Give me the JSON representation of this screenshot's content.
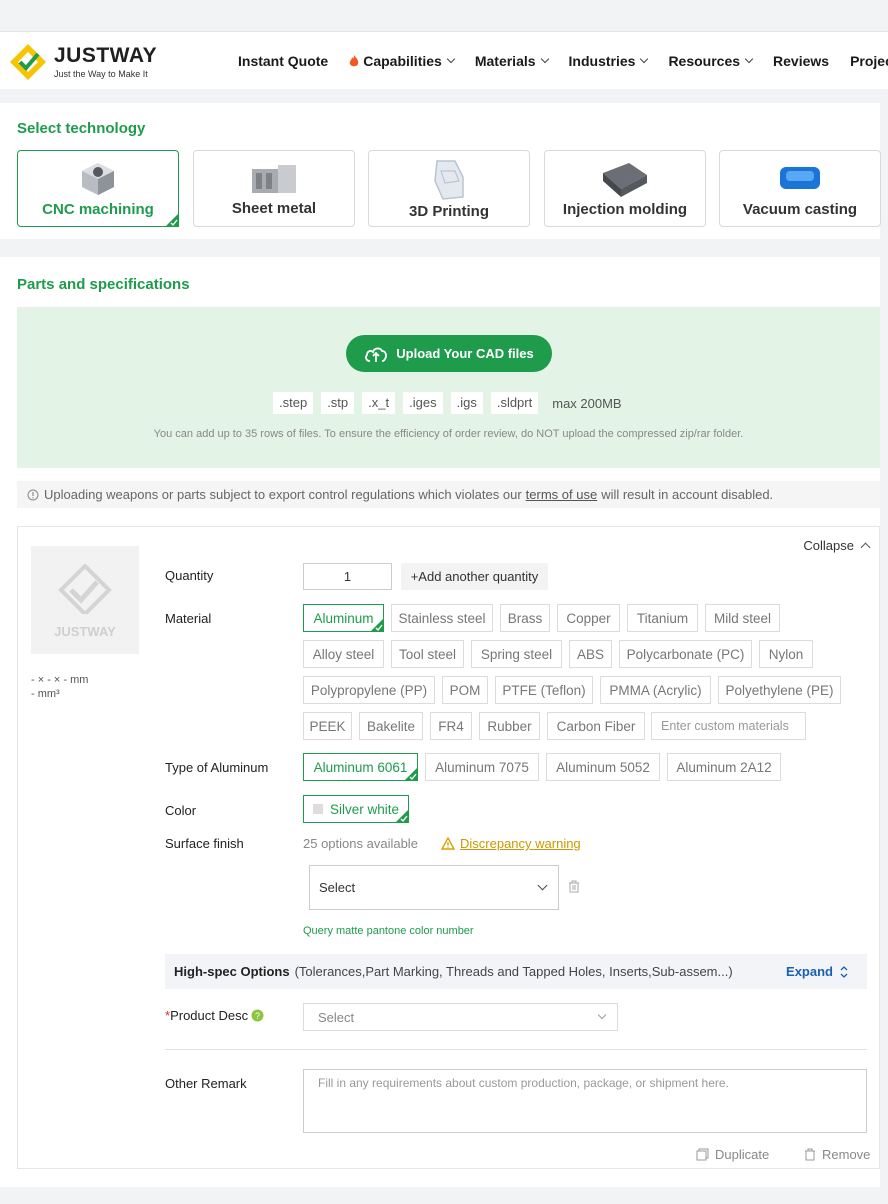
{
  "header": {
    "logo_text": "JUSTWAY",
    "logo_tagline": "Just the Way to Make It",
    "nav": [
      {
        "label": "Instant Quote",
        "dropdown": false
      },
      {
        "label": "Capabilities",
        "dropdown": true,
        "icon": "fire-icon"
      },
      {
        "label": "Materials",
        "dropdown": true
      },
      {
        "label": "Industries",
        "dropdown": true
      },
      {
        "label": "Resources",
        "dropdown": true
      },
      {
        "label": "Reviews",
        "dropdown": false
      },
      {
        "label": "Project",
        "dropdown": false
      }
    ]
  },
  "technology": {
    "title": "Select technology",
    "options": [
      {
        "label": "CNC machining",
        "selected": true
      },
      {
        "label": "Sheet metal",
        "selected": false
      },
      {
        "label": "3D Printing",
        "selected": false
      },
      {
        "label": "Injection molding",
        "selected": false
      },
      {
        "label": "Vacuum casting",
        "selected": false
      }
    ]
  },
  "parts": {
    "title": "Parts and specifications",
    "upload_button": "Upload Your CAD files",
    "extensions": [
      ".step",
      ".stp",
      ".x_t",
      ".iges",
      ".igs",
      ".sldprt"
    ],
    "max_size": "max 200MB",
    "note": "You can add up to 35 rows of files. To ensure the efficiency of order review, do NOT upload the compressed zip/rar folder.",
    "warning_prefix": "Uploading weapons or parts subject to export control regulations which violates our",
    "warning_link": "terms of use",
    "warning_suffix": "will result in account disabled."
  },
  "spec": {
    "collapse_label": "Collapse",
    "thumb_logo": "JUSTWAY",
    "dims_line1": "- × - × - mm",
    "dims_line2": "- mm³",
    "quantity_label": "Quantity",
    "quantity_value": "1",
    "add_quantity": "+Add another quantity",
    "material_label": "Material",
    "materials": [
      "Aluminum",
      "Stainless steel",
      "Brass",
      "Copper",
      "Titanium",
      "Mild steel",
      "Alloy steel",
      "Tool steel",
      "Spring steel",
      "ABS",
      "Polycarbonate (PC)",
      "Nylon",
      "Polypropylene (PP)",
      "POM",
      "PTFE (Teflon)",
      "PMMA (Acrylic)",
      "Polyethylene (PE)",
      "PEEK",
      "Bakelite",
      "FR4",
      "Rubber",
      "Carbon Fiber"
    ],
    "selected_material": "Aluminum",
    "custom_material_placeholder": "Enter custom materials",
    "type_label": "Type of Aluminum",
    "types": [
      "Aluminum 6061",
      "Aluminum 7075",
      "Aluminum 5052",
      "Aluminum 2A12"
    ],
    "selected_type": "Aluminum 6061",
    "color_label": "Color",
    "color_value": "Silver white",
    "surface_label": "Surface finish",
    "surface_options": "25 options available",
    "discrepancy": "Discrepancy warning",
    "surface_select": "Select",
    "query_link": "Query matte pantone color number",
    "highspec_title": "High-spec Options",
    "highspec_sub": "(Tolerances,Part Marking, Threads and Tapped Holes, Inserts,Sub-assem...)",
    "expand_label": "Expand",
    "product_desc_required": "*",
    "product_desc_label": "Product Desc",
    "product_desc_select": "Select",
    "remark_label": "Other Remark",
    "remark_placeholder": "Fill in any requirements about custom production, package, or shipment here.",
    "duplicate_label": "Duplicate",
    "remove_label": "Remove"
  },
  "colors": {
    "accent": "#1e9c4b",
    "upload_bg": "#e3f4e6",
    "link_blue": "#1a5fb4",
    "warning": "#c99a00"
  }
}
